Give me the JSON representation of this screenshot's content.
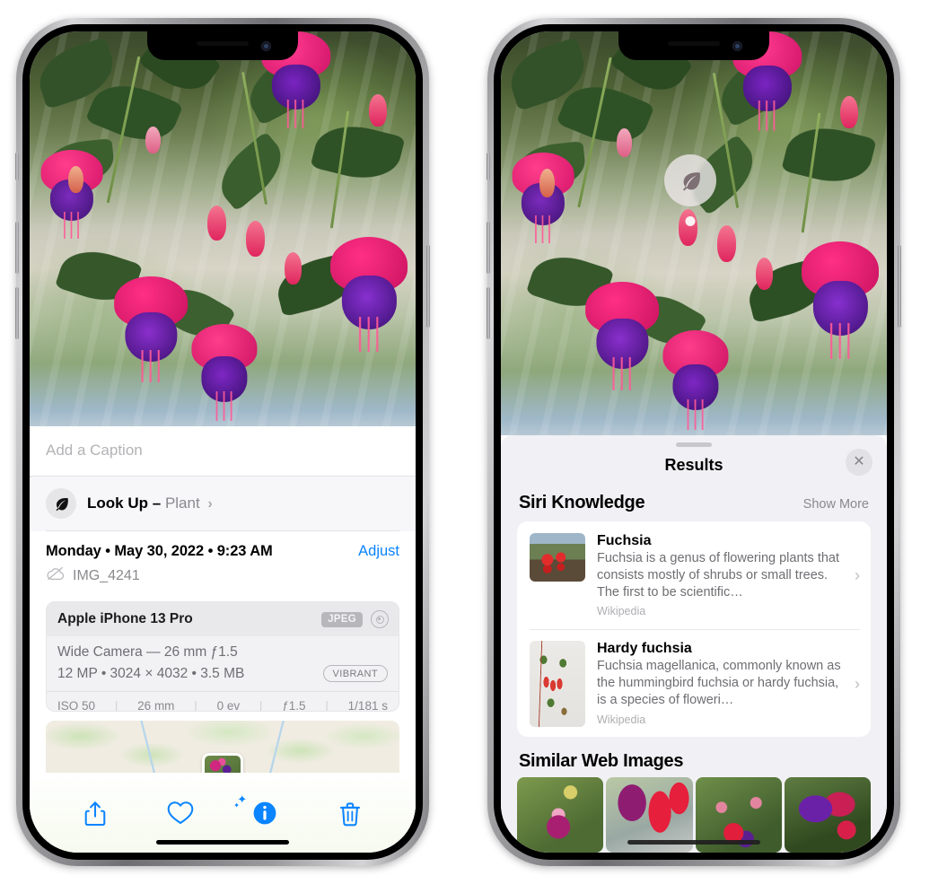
{
  "left_phone": {
    "caption_placeholder": "Add a Caption",
    "lookup": {
      "label": "Look Up",
      "dash": "–",
      "kind": "Plant",
      "chevron": "›",
      "icon": "leaf-icon"
    },
    "meta": {
      "date": "Monday • May 30, 2022 • 9:23 AM",
      "adjust_label": "Adjust",
      "filename": "IMG_4241",
      "sync_icon": "cloud-slash-icon"
    },
    "exif": {
      "device": "Apple iPhone 13 Pro",
      "format_badge": "JPEG",
      "lens_icon": "lens-aperture-icon",
      "line1": "Wide Camera — 26 mm ƒ1.5",
      "line2": "12 MP • 3024 × 4032 • 3.5 MB",
      "style_badge": "VIBRANT",
      "stats": [
        "ISO 50",
        "26 mm",
        "0 ev",
        "ƒ1.5",
        "1/181 s"
      ],
      "separator": "|"
    },
    "toolbar": [
      {
        "name": "share-button",
        "icon": "share-icon"
      },
      {
        "name": "favorite-button",
        "icon": "heart-icon"
      },
      {
        "name": "info-button",
        "icon": "info-sparkle-icon"
      },
      {
        "name": "delete-button",
        "icon": "trash-icon"
      }
    ]
  },
  "right_phone": {
    "marker": {
      "icon": "leaf-icon"
    },
    "sheet": {
      "title": "Results",
      "close_icon": "close-icon",
      "grabber": "drag-handle"
    },
    "siri_knowledge": {
      "title": "Siri Knowledge",
      "show_more": "Show More",
      "items": [
        {
          "title": "Fuchsia",
          "description": "Fuchsia is a genus of flowering plants that consists mostly of shrubs or small trees. The first to be scientific…",
          "source": "Wikipedia",
          "chevron": "›"
        },
        {
          "title": "Hardy fuchsia",
          "description": "Fuchsia magellanica, commonly known as the hummingbird fuchsia or hardy fuchsia, is a species of floweri…",
          "source": "Wikipedia",
          "chevron": "›"
        }
      ]
    },
    "similar_web_images": {
      "title": "Similar Web Images",
      "count": 4
    }
  },
  "colors": {
    "accent_blue": "#0a84ff",
    "sheet_bg": "#f1f1f5",
    "card_bg": "#ffffff",
    "secondary_text": "#8a8a8e"
  }
}
